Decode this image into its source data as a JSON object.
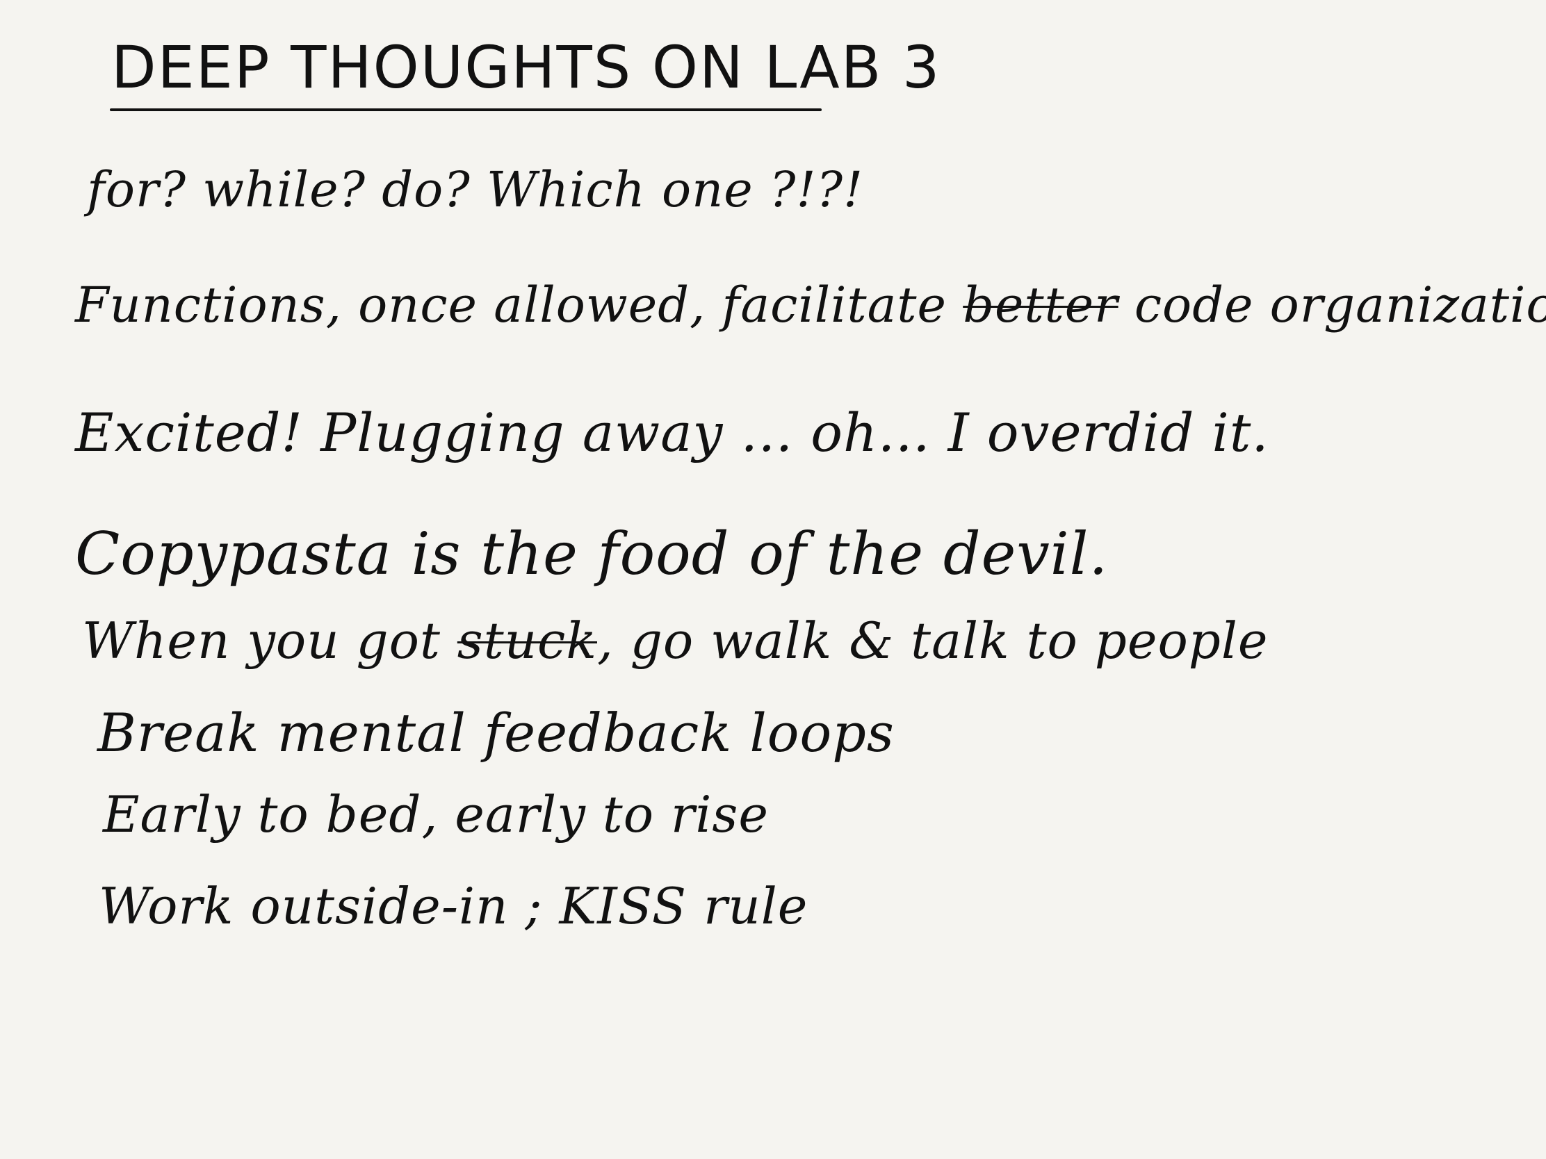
{
  "note": {
    "title": "Deep Thoughts On Lab 3",
    "lines": [
      {
        "text": "for? while? do? Which one ?!?!"
      },
      {
        "before": "Functions, once allowed, facilitate ",
        "struck": "better",
        "after": " code organization"
      },
      {
        "text": "Excited! Plugging away ... oh... I overdid it."
      },
      {
        "text": "Copypasta is the food of the devil."
      },
      {
        "before": "When you got ",
        "struck": "stuck",
        "after": ", go walk & talk to people"
      },
      {
        "text": "Break mental feedback loops"
      },
      {
        "text": "Early to bed, early to rise"
      },
      {
        "text": "Work outside-in ; KISS rule"
      }
    ]
  },
  "colors": {
    "paper": "#f5f4f0",
    "ink": "#111111"
  }
}
